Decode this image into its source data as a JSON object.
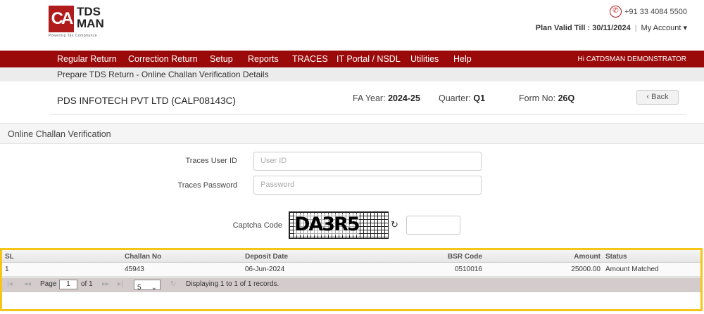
{
  "header": {
    "logo": {
      "mark": "CA",
      "name_line1": "TDS",
      "name_line2": "MAN",
      "tagline": "Powering Tax Compliance"
    },
    "phone": "+91 33 4084 5500",
    "plan_label": "Plan Valid Till :",
    "plan_date": "30/11/2024",
    "my_account": "My Account"
  },
  "nav": {
    "items": [
      "Regular Return",
      "Correction Return",
      "Setup",
      "Reports",
      "TRACES",
      "IT Portal / NSDL",
      "Utilities",
      "Help"
    ],
    "greeting": "Hi CATDSMAN DEMONSTRATOR"
  },
  "breadcrumb": "Prepare TDS Return - Online Challan Verification Details",
  "info": {
    "company": "PDS INFOTECH PVT LTD (CALP08143C)",
    "fa_year_label": "FA Year:",
    "fa_year": "2024-25",
    "quarter_label": "Quarter:",
    "quarter": "Q1",
    "form_label": "Form No:",
    "form": "26Q",
    "back": "Back"
  },
  "panel_title": "Online Challan Verification",
  "form": {
    "user_id_label": "Traces User ID",
    "user_id_placeholder": "User ID",
    "password_label": "Traces Password",
    "password_placeholder": "Password",
    "captcha_label": "Captcha Code",
    "captcha_text": "DA3R5"
  },
  "grid": {
    "columns": [
      "SL",
      "Challan No",
      "Deposit Date",
      "BSR Code",
      "Amount",
      "Status"
    ],
    "rows": [
      [
        "1",
        "45943",
        "06-Jun-2024",
        "0510016",
        "25000.00",
        "Amount Matched"
      ]
    ],
    "pager": {
      "page_label": "Page",
      "page": "1",
      "of": "of 1",
      "page_size": "5",
      "summary": "Displaying 1 to 1 of 1 records."
    }
  },
  "colors": {
    "brand": "#9b0a0a",
    "highlight": "#f5c518"
  }
}
